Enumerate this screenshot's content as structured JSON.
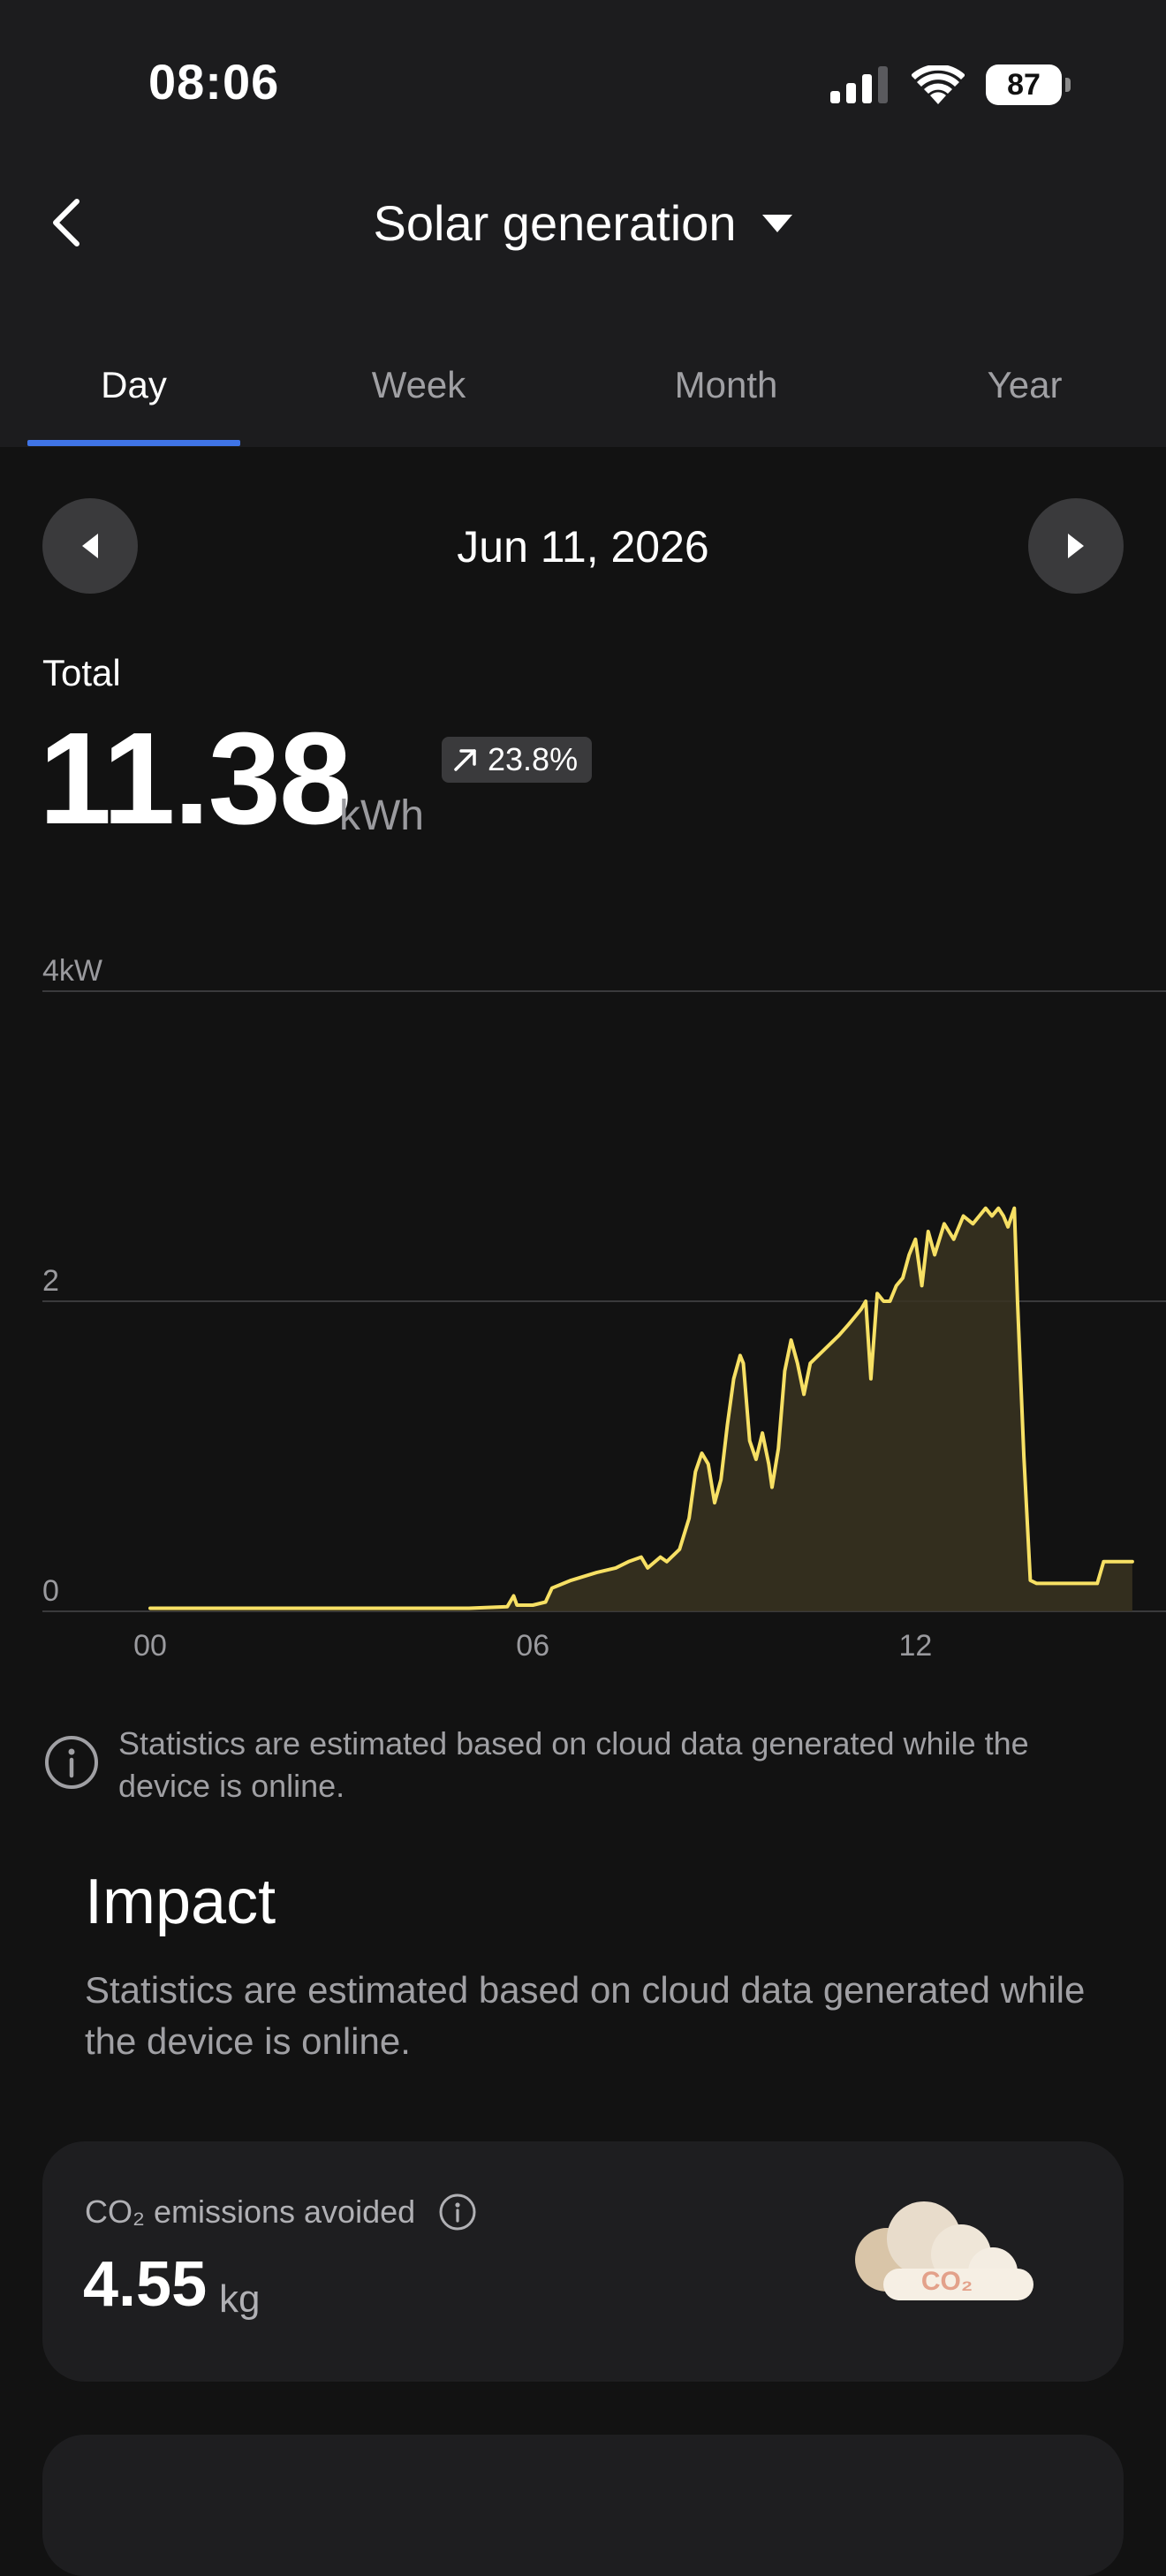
{
  "status_bar": {
    "time": "08:06",
    "battery": "87"
  },
  "nav": {
    "title": "Solar generation"
  },
  "tabs": [
    {
      "label": "Day",
      "active": true
    },
    {
      "label": "Week",
      "active": false
    },
    {
      "label": "Month",
      "active": false
    },
    {
      "label": "Year",
      "active": false
    }
  ],
  "date": {
    "label": "Jun 11, 2026"
  },
  "summary": {
    "label": "Total",
    "value": "11.38",
    "unit": "kWh",
    "change": "23.8%",
    "change_direction": "up"
  },
  "chart_data": {
    "type": "area",
    "title": "",
    "xlabel": "",
    "ylabel": "",
    "unit_label": "4kW",
    "y_ticks": [
      "4kW",
      "2",
      "0"
    ],
    "y_tick_values": [
      4,
      2,
      0
    ],
    "x_ticks": [
      "00",
      "06",
      "12"
    ],
    "x_tick_values": [
      0,
      6,
      12
    ],
    "xlim": [
      0,
      15.4
    ],
    "ylim": [
      0,
      4
    ],
    "line_color": "#f7e064",
    "fill_color": "#3a3421",
    "grid": true,
    "series": [
      {
        "values": [
          [
            0,
            0.02
          ],
          [
            1,
            0.02
          ],
          [
            2,
            0.02
          ],
          [
            3,
            0.02
          ],
          [
            4,
            0.02
          ],
          [
            5,
            0.02
          ],
          [
            5.6,
            0.03
          ],
          [
            5.7,
            0.1
          ],
          [
            5.75,
            0.04
          ],
          [
            6.0,
            0.04
          ],
          [
            6.2,
            0.06
          ],
          [
            6.3,
            0.15
          ],
          [
            6.6,
            0.2
          ],
          [
            7.0,
            0.25
          ],
          [
            7.3,
            0.28
          ],
          [
            7.5,
            0.32
          ],
          [
            7.7,
            0.35
          ],
          [
            7.8,
            0.28
          ],
          [
            8.0,
            0.35
          ],
          [
            8.1,
            0.32
          ],
          [
            8.3,
            0.4
          ],
          [
            8.45,
            0.6
          ],
          [
            8.55,
            0.9
          ],
          [
            8.65,
            1.02
          ],
          [
            8.75,
            0.95
          ],
          [
            8.85,
            0.7
          ],
          [
            8.95,
            0.85
          ],
          [
            9.05,
            1.2
          ],
          [
            9.15,
            1.5
          ],
          [
            9.25,
            1.65
          ],
          [
            9.3,
            1.6
          ],
          [
            9.4,
            1.1
          ],
          [
            9.5,
            0.98
          ],
          [
            9.6,
            1.15
          ],
          [
            9.7,
            0.95
          ],
          [
            9.75,
            0.8
          ],
          [
            9.85,
            1.05
          ],
          [
            9.95,
            1.55
          ],
          [
            10.05,
            1.75
          ],
          [
            10.15,
            1.6
          ],
          [
            10.25,
            1.4
          ],
          [
            10.35,
            1.6
          ],
          [
            10.6,
            1.7
          ],
          [
            10.8,
            1.78
          ],
          [
            10.95,
            1.85
          ],
          [
            11.05,
            1.9
          ],
          [
            11.15,
            1.95
          ],
          [
            11.22,
            2.0
          ],
          [
            11.3,
            1.5
          ],
          [
            11.4,
            2.05
          ],
          [
            11.5,
            2.0
          ],
          [
            11.6,
            2.0
          ],
          [
            11.7,
            2.1
          ],
          [
            11.8,
            2.15
          ],
          [
            11.9,
            2.3
          ],
          [
            12.0,
            2.4
          ],
          [
            12.1,
            2.1
          ],
          [
            12.2,
            2.45
          ],
          [
            12.3,
            2.3
          ],
          [
            12.45,
            2.5
          ],
          [
            12.6,
            2.4
          ],
          [
            12.75,
            2.55
          ],
          [
            12.9,
            2.5
          ],
          [
            13.0,
            2.55
          ],
          [
            13.1,
            2.6
          ],
          [
            13.2,
            2.55
          ],
          [
            13.3,
            2.6
          ],
          [
            13.38,
            2.55
          ],
          [
            13.45,
            2.48
          ],
          [
            13.55,
            2.6
          ],
          [
            13.6,
            2.0
          ],
          [
            13.7,
            1.0
          ],
          [
            13.8,
            0.2
          ],
          [
            13.9,
            0.18
          ],
          [
            14.0,
            0.18
          ],
          [
            14.4,
            0.18
          ],
          [
            14.8,
            0.18
          ],
          [
            14.85,
            0.18
          ],
          [
            14.95,
            0.32
          ],
          [
            15.4,
            0.32
          ]
        ]
      }
    ]
  },
  "info_note": {
    "text": "Statistics are estimated based on cloud data generated while the device is online."
  },
  "impact": {
    "title": "Impact",
    "description": "Statistics are estimated based on cloud data generated while the device is online."
  },
  "co2_card": {
    "label": "CO₂ emissions avoided",
    "value": "4.55",
    "unit": "kg",
    "cloud_text": "CO₂"
  },
  "colors": {
    "accent": "#3f74e6",
    "chart_line": "#f7e064",
    "background": "#121212",
    "header_bg": "#1c1c1e",
    "card_bg": "#1e1e20"
  }
}
